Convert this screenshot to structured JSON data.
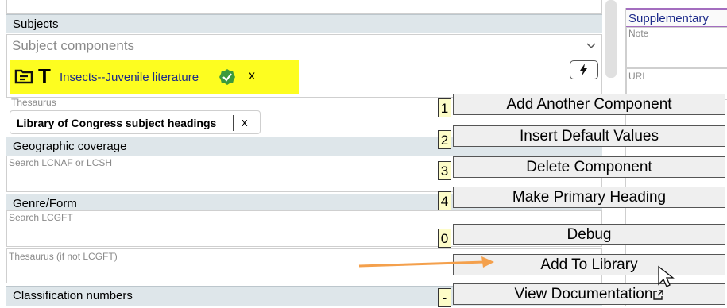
{
  "subjects": {
    "heading": "Subjects",
    "components_placeholder": "Subject components",
    "chevron": "chevron-down-icon",
    "selected_heading": "Insects--Juvenile literature",
    "remove": "x",
    "action": "lightning-icon",
    "thesaurus_label": "Thesaurus",
    "thesaurus_value": "Library of Congress subject headings",
    "thesaurus_remove": "x"
  },
  "geographic": {
    "heading": "Geographic coverage",
    "placeholder": "Search LCNAF or LCSH"
  },
  "genre": {
    "heading": "Genre/Form",
    "placeholder": "Search LCGFT",
    "thesaurus_label": "Thesaurus (if not LCGFT)"
  },
  "classification": {
    "heading": "Classification numbers"
  },
  "supplementary": {
    "heading": "Supplementary",
    "note_label": "Note",
    "url_label": "URL"
  },
  "menu": [
    {
      "key": "1",
      "label": "Add Another Component"
    },
    {
      "key": "2",
      "label": "Insert Default Values"
    },
    {
      "key": "3",
      "label": "Delete Component"
    },
    {
      "key": "4",
      "label": "Make Primary Heading"
    },
    {
      "key": "0",
      "label": "Debug"
    },
    {
      "key": "",
      "label": "Add To Library"
    },
    {
      "key": "-",
      "label": "View Documentation"
    }
  ],
  "colors": {
    "highlight": "#fdfd20",
    "arrow": "#f4a04c",
    "badge": "#3c9a3c",
    "supplementary_accent": "#a36dbf"
  }
}
